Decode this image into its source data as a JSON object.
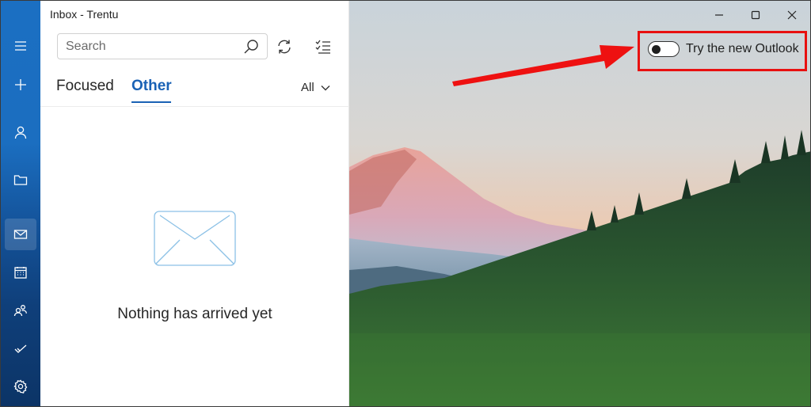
{
  "window": {
    "title": "Inbox - Trentu",
    "controls": [
      "minimize",
      "maximize",
      "close"
    ]
  },
  "rail": {
    "items": [
      {
        "id": "menu",
        "icon": "hamburger-icon"
      },
      {
        "id": "new-mail",
        "icon": "plus-icon"
      },
      {
        "id": "accounts",
        "icon": "person-icon"
      },
      {
        "id": "folders",
        "icon": "folder-icon"
      },
      {
        "id": "mail",
        "icon": "mail-icon",
        "active": true
      },
      {
        "id": "calendar",
        "icon": "calendar-icon"
      },
      {
        "id": "people",
        "icon": "people-icon"
      },
      {
        "id": "todo",
        "icon": "checkmark-icon"
      },
      {
        "id": "settings",
        "icon": "gear-icon"
      }
    ]
  },
  "search": {
    "placeholder": "Search",
    "value": ""
  },
  "toolbar": {
    "sync_icon": "sync-icon",
    "select_icon": "checklist-icon"
  },
  "tabs": [
    {
      "label": "Focused",
      "active": false
    },
    {
      "label": "Other",
      "active": true
    }
  ],
  "filter": {
    "selected": "All"
  },
  "empty_state": {
    "icon": "envelope-icon",
    "message": "Nothing has arrived yet"
  },
  "new_outlook": {
    "label": "Try the new Outlook",
    "toggle_on": false
  },
  "annotation": {
    "color": "#e81010",
    "type": "arrow-and-box"
  },
  "colors": {
    "accent": "#1a62b5",
    "rail_top": "#1b6fc2",
    "rail_bottom": "#0c3466"
  }
}
